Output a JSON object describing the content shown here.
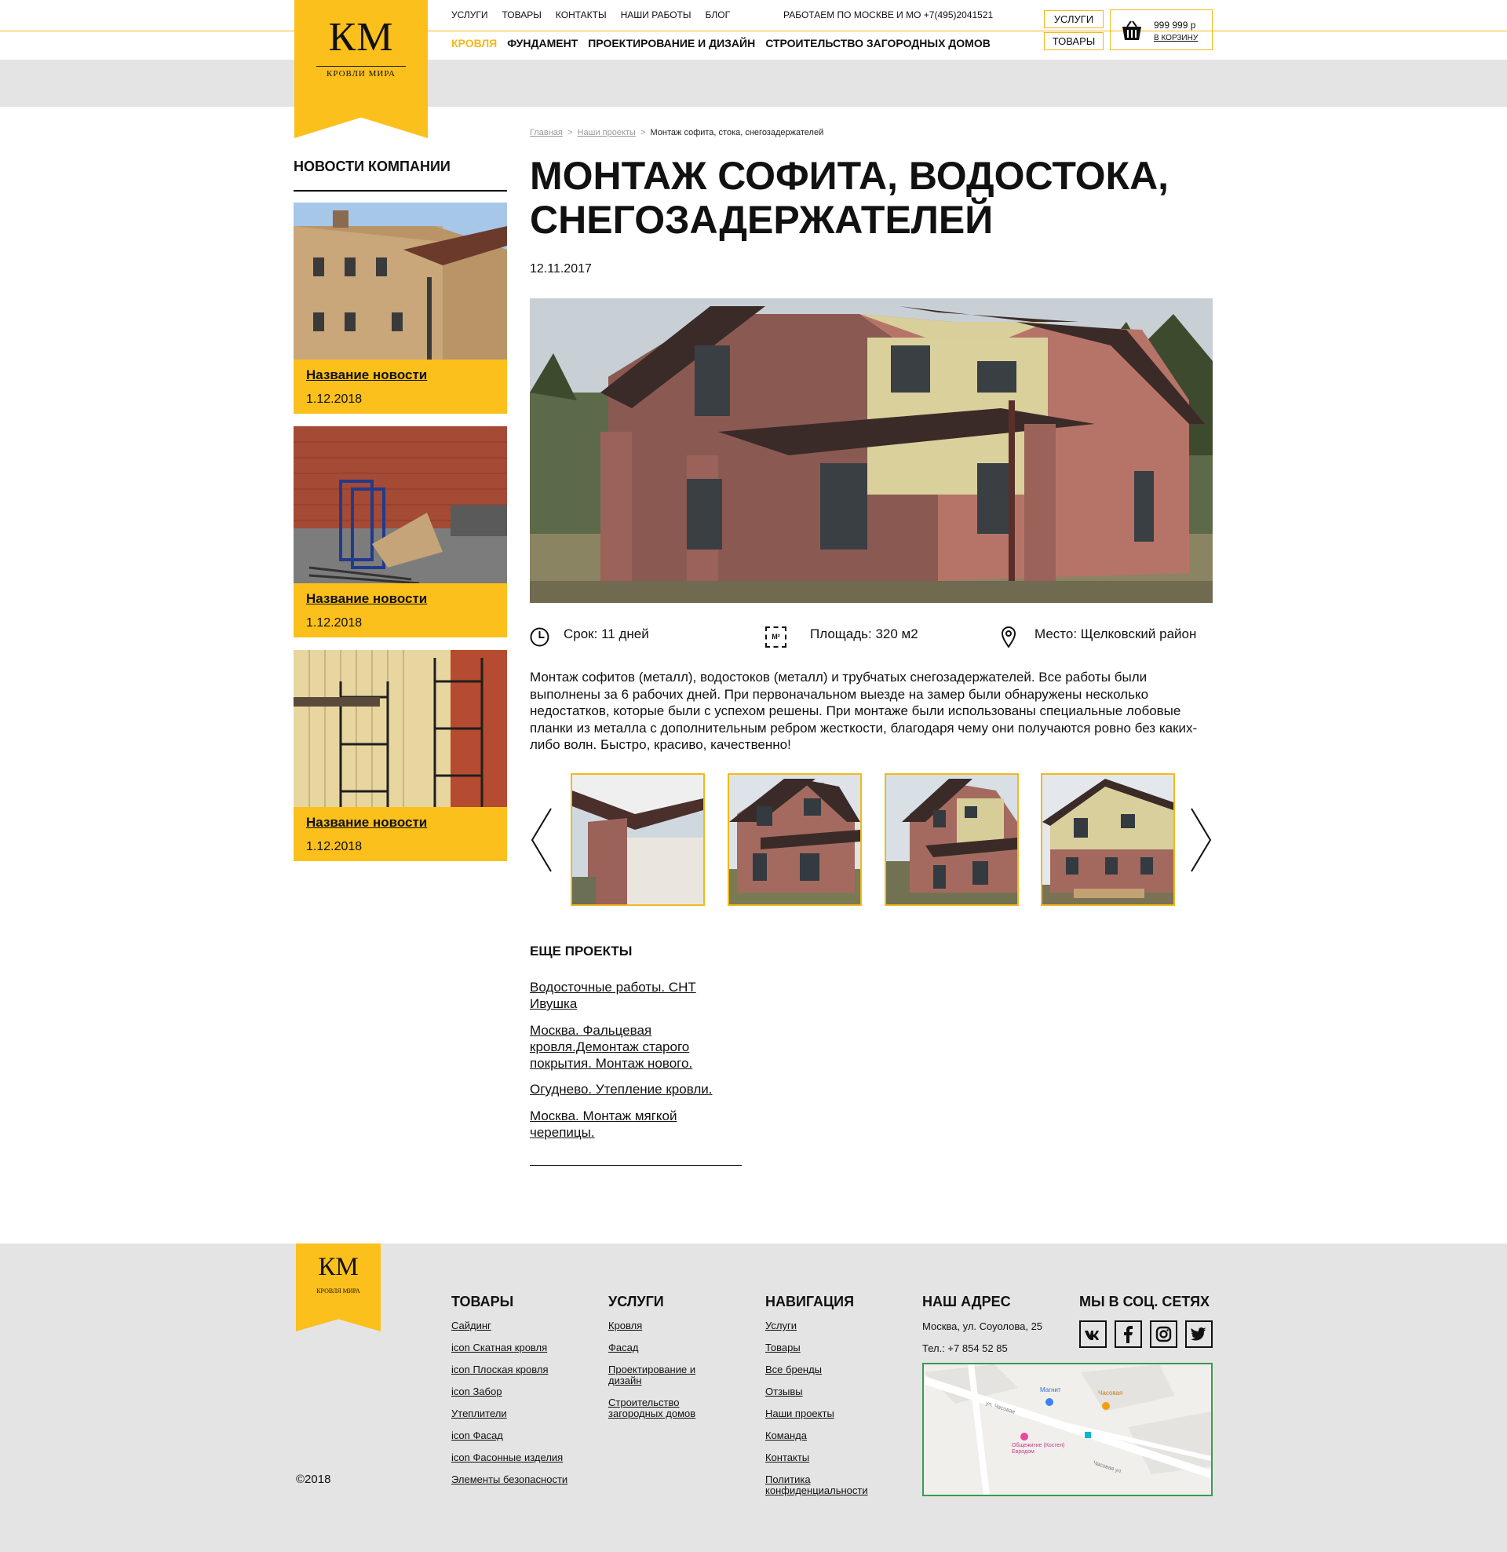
{
  "header": {
    "logo_text": "КМ",
    "logo_sub": "КРОВЛИ МИРА",
    "top_nav": [
      "УСЛУГИ",
      "ТОВАРЫ",
      "КОНТАКТЫ",
      "НАШИ РАБОТЫ",
      "БЛОГ"
    ],
    "work_info": "РАБОТАЕМ ПО МОСКВЕ И МО +7(495)2041521",
    "sub_nav": [
      "КРОВЛЯ",
      "ФУНДАМЕНТ",
      "ПРОЕКТИРОВАНИЕ И ДИЗАЙН",
      "СТРОИТЕЛЬСТВО ЗАГОРОДНЫХ ДОМОВ"
    ],
    "btn_services": "УСЛУГИ",
    "btn_goods": "ТОВАРЫ",
    "cart_amount": "999 999 р",
    "cart_link": "В КОРЗИНУ"
  },
  "sidebar": {
    "heading": "НОВОСТИ КОМПАНИИ",
    "news": [
      {
        "title": "Название новости",
        "date": "1.12.2018"
      },
      {
        "title": "Название новости",
        "date": "1.12.2018"
      },
      {
        "title": "Название новости",
        "date": "1.12.2018"
      }
    ]
  },
  "breadcrumb": {
    "home": "Главная",
    "sep": ">",
    "projects": "Наши проекты",
    "current": "Монтаж софита, стока, снегозадержателей"
  },
  "article": {
    "title": "МОНТАЖ СОФИТА, ВОДОСТОКА, СНЕГОЗАДЕРЖАТЕЛЕЙ",
    "date": "12.11.2017",
    "term": "Срок: 11 дней",
    "area": "Площадь: 320 м2",
    "area_icon_text": "M²",
    "place": "Место: Щелковский район",
    "description": "Монтаж софитов (металл), водостоков (металл) и трубчатых снегозадержателей. Все работы были выполнены за 6 рабочих дней. При первоначальном выезде на замер были обнаружены несколько недостатков, которые были с успехом решены. При монтаже были использованы специальные лобовые планки из металла с дополнительным ребром жесткости, благодаря чему они получаются ровно без каких-либо волн. Быстро, красиво, качественно!"
  },
  "more": {
    "heading": "ЕЩЕ ПРОЕКТЫ",
    "links": [
      "Водосточные работы. СНТ Ивушка",
      "Москва. Фальцевая кровля.Демонтаж старого покрытия. Монтаж нового.",
      "Огуднево. Утепление кровли.",
      "Москва. Монтаж мягкой черепицы."
    ]
  },
  "footer": {
    "logo_text": "КМ",
    "logo_sub": "КРОВЛЯ МИРА",
    "goods_h": "ТОВАРЫ",
    "goods": [
      "Сайдинг",
      "icon Скатная кровля",
      "icon Плоская кровля",
      "icon Забор",
      "Утеплители",
      "icon Фасад",
      "icon Фасонные изделия",
      "Элементы безопасности"
    ],
    "services_h": "УСЛУГИ",
    "services": [
      "Кровля",
      "Фасад",
      "Проектирование и дизайн",
      "Строительство загородных домов"
    ],
    "nav_h": "НАВИГАЦИЯ",
    "nav": [
      "Услуги",
      "Товары",
      "Все бренды",
      "Отзывы",
      "Наши проекты",
      "Команда",
      "Контакты",
      "Политика конфиденциальности"
    ],
    "addr_h": "НАШ АДРЕС",
    "address": "Москва, ул. Соуолова, 25",
    "phone": "Тел.: +7 854 52 85",
    "social_h": "МЫ В СОЦ. СЕТЯХ",
    "social": [
      "vk-icon",
      "facebook-icon",
      "instagram-icon",
      "twitter-icon"
    ],
    "map_labels": [
      "Магнит",
      "Часовая",
      "Общежитие (Костел) Евродом",
      "ул. Часовая",
      "Часовая ул."
    ],
    "copyright": "©2018"
  },
  "colors": {
    "accent": "#fbc01c",
    "grey": "#e4e4e4",
    "text": "#111111"
  }
}
